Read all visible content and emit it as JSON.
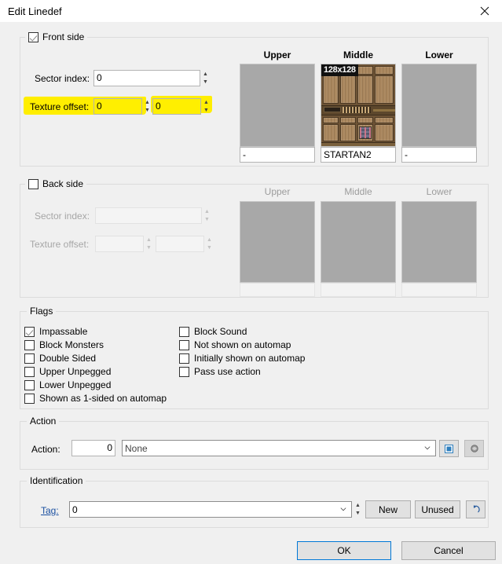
{
  "window": {
    "title": "Edit Linedef",
    "close_icon": "close-icon"
  },
  "front_side": {
    "legend": "Front side",
    "checked": true,
    "sector_index_label": "Sector index:",
    "sector_index_value": "0",
    "texture_offset_label": "Texture offset:",
    "texture_offset_x": "0",
    "texture_offset_y": "0",
    "textures": [
      {
        "header": "Upper",
        "name": "-",
        "size": "",
        "has_image": false
      },
      {
        "header": "Middle",
        "name": "STARTAN2",
        "size": "128x128",
        "has_image": true
      },
      {
        "header": "Lower",
        "name": "-",
        "size": "",
        "has_image": false
      }
    ]
  },
  "back_side": {
    "legend": "Back side",
    "checked": false,
    "sector_index_label": "Sector index:",
    "sector_index_value": "",
    "texture_offset_label": "Texture offset:",
    "texture_offset_x": "",
    "texture_offset_y": "",
    "textures": [
      {
        "header": "Upper",
        "name": ""
      },
      {
        "header": "Middle",
        "name": ""
      },
      {
        "header": "Lower",
        "name": ""
      }
    ]
  },
  "flags": {
    "legend": "Flags",
    "left_column": [
      {
        "label": "Impassable",
        "checked": true
      },
      {
        "label": "Block Monsters",
        "checked": false
      },
      {
        "label": "Double Sided",
        "checked": false
      },
      {
        "label": "Upper Unpegged",
        "checked": false
      },
      {
        "label": "Lower Unpegged",
        "checked": false
      },
      {
        "label": "Shown as 1-sided on automap",
        "checked": false
      }
    ],
    "right_column": [
      {
        "label": "Block Sound",
        "checked": false
      },
      {
        "label": "Not shown on automap",
        "checked": false
      },
      {
        "label": "Initially shown on automap",
        "checked": false
      },
      {
        "label": "Pass use action",
        "checked": false
      }
    ]
  },
  "action": {
    "legend": "Action",
    "label": "Action:",
    "number_value": "0",
    "selected": "None",
    "browse_icon": "window-icon",
    "tag_icon": "paint-icon"
  },
  "identification": {
    "legend": "Identification",
    "tag_label": "Tag:",
    "tag_value": "0",
    "new_button": "New",
    "unused_button": "Unused",
    "reset_icon": "undo-arrow-icon"
  },
  "footer": {
    "ok": "OK",
    "cancel": "Cancel"
  },
  "colors": {
    "accent": "#0078d7",
    "highlight": "#ffee00",
    "link": "#1a4fa0",
    "dialog_bg": "#f0f0f0",
    "preview_gray": "#a8a8a8"
  }
}
